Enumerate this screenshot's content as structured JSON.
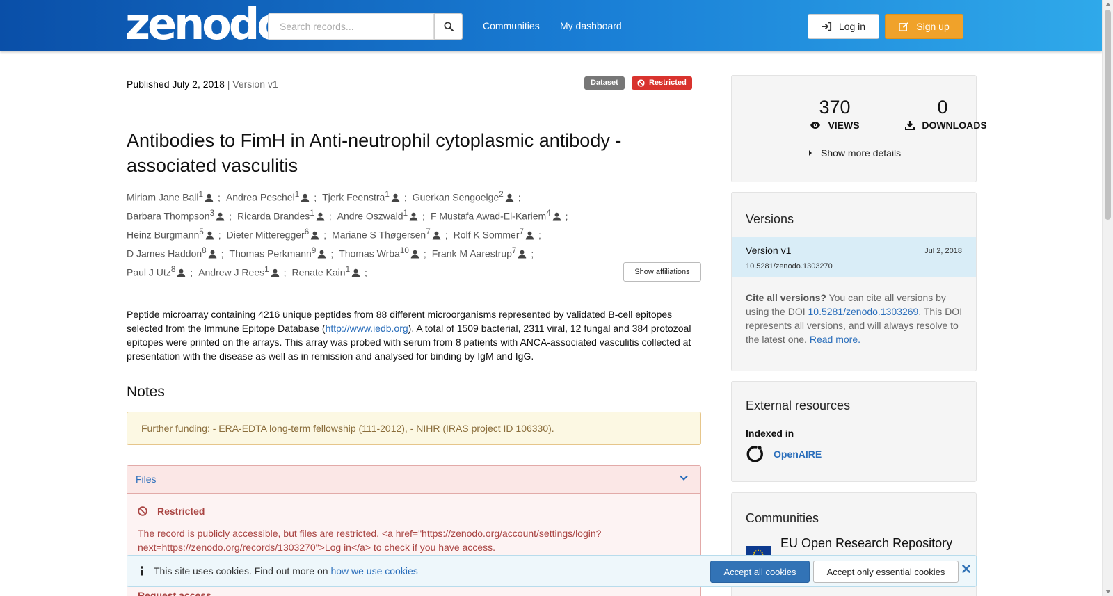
{
  "header": {
    "logo": "zenodo",
    "search_placeholder": "Search records...",
    "nav": [
      "Communities",
      "My dashboard"
    ],
    "login_label": "Log in",
    "signup_label": "Sign up"
  },
  "record": {
    "published": "Published July 2, 2018",
    "version": "| Version v1",
    "badge_type": "Dataset",
    "badge_access": "Restricted",
    "title": "Antibodies to FimH in Anti-neutrophil cytoplasmic antibody - associated vasculitis",
    "authors": [
      [
        {
          "name": "Miriam Jane Ball",
          "sup": "1"
        },
        {
          "name": "Andrea Peschel",
          "sup": "1"
        },
        {
          "name": "Tjerk Feenstra",
          "sup": "1"
        },
        {
          "name": "Guerkan Sengoelge",
          "sup": "2"
        }
      ],
      [
        {
          "name": "Barbara Thompson",
          "sup": "3"
        },
        {
          "name": "Ricarda Brandes",
          "sup": "1"
        },
        {
          "name": "Andre Oszwald",
          "sup": "1"
        },
        {
          "name": "F Mustafa Awad-El-Kariem",
          "sup": "4"
        }
      ],
      [
        {
          "name": "Heinz Burgmann",
          "sup": "5"
        },
        {
          "name": "Dieter Mitteregger",
          "sup": "6"
        },
        {
          "name": "Mariane S Thøgersen",
          "sup": "7"
        },
        {
          "name": "Rolf K Sommer",
          "sup": "7"
        }
      ],
      [
        {
          "name": "D James Haddon",
          "sup": "8"
        },
        {
          "name": "Thomas Perkmann",
          "sup": "9"
        },
        {
          "name": "Thomas Wrba",
          "sup": "10"
        },
        {
          "name": "Frank M Aarestrup",
          "sup": "7"
        }
      ],
      [
        {
          "name": "Paul J Utz",
          "sup": "8"
        },
        {
          "name": "Andrew J Rees",
          "sup": "1"
        },
        {
          "name": "Renate Kain",
          "sup": "1"
        }
      ]
    ],
    "show_affiliations": "Show affiliations",
    "desc_part1": "Peptide microarray containing 4216 unique peptides from 88 different microorganisms represented by validated B-cell epitopes selected from the Immune Epitope Database (",
    "desc_link": "http://www.iedb.org",
    "desc_part2": "). A total of 1509 bacterial, 2311 viral, 12 fungal and 384 protozoal epitopes were printed on the arrays. This array was probed with serum from 8 patients with ANCA-associated vasculitis collected at presentation with the disease as well as in remission and analysed for binding by IgM and IgG.",
    "notes_heading": "Notes",
    "notes_text": "Further funding: - ERA-EDTA long-term fellowship (111-2012), - NIHR (IRAS project ID 106330).",
    "files_label": "Files",
    "restricted_heading": "Restricted",
    "restricted_text": "The record is publicly accessible, but files are restricted. <a href=\"https://zenodo.org/account/settings/login?next=https://zenodo.org/records/1303270\">Log in</a> to check if you have access.",
    "request_access": "Request access"
  },
  "stats": {
    "views": "370",
    "views_label": "VIEWS",
    "downloads": "0",
    "downloads_label": "DOWNLOADS",
    "more_details": "Show more details"
  },
  "versions": {
    "heading": "Versions",
    "name": "Version v1",
    "date": "Jul 2, 2018",
    "doi": "10.5281/zenodo.1303270",
    "cite_bold": "Cite all versions?",
    "cite_text1": " You can cite all versions by using the DOI ",
    "cite_doi": "10.5281/zenodo.1303269",
    "cite_text2": ". This DOI represents all versions, and will always resolve to the latest one. ",
    "read_more": "Read more."
  },
  "external": {
    "heading": "External resources",
    "indexed_in": "Indexed in",
    "openaire": "OpenAIRE"
  },
  "communities": {
    "heading": "Communities",
    "name": "EU Open Research Repository"
  },
  "cookies": {
    "text": "This site uses cookies. Find out more on ",
    "link": "how we use cookies",
    "accept_all": "Accept all cookies",
    "accept_essential": "Accept only essential cookies"
  },
  "colors": {
    "header_start": "#0a4fa8",
    "header_end": "#2fa9ea",
    "signup": "#f0a22a",
    "restricted": "#d9332e",
    "link": "#2a6ebb"
  }
}
